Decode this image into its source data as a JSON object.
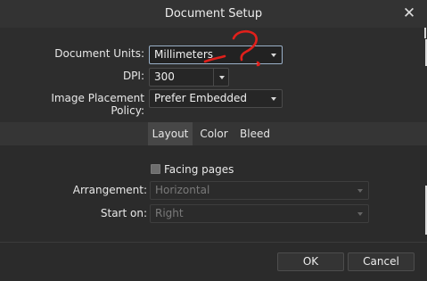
{
  "dialog": {
    "title": "Document Setup",
    "close_glyph": "✕"
  },
  "top": {
    "document_units": {
      "label": "Document Units:",
      "value": "Millimeters"
    },
    "dpi": {
      "label": "DPI:",
      "value": "300"
    },
    "placement": {
      "label": "Image Placement Policy:",
      "value": "Prefer Embedded"
    }
  },
  "tabs": [
    {
      "label": "Layout",
      "active": true
    },
    {
      "label": "Color",
      "active": false
    },
    {
      "label": "Bleed",
      "active": false
    }
  ],
  "layout": {
    "facing_pages": {
      "label": "Facing pages",
      "checked": false
    },
    "arrangement": {
      "label": "Arrangement:",
      "value": "Horizontal",
      "enabled": false
    },
    "start_on": {
      "label": "Start on:",
      "value": "Right",
      "enabled": false
    }
  },
  "footer": {
    "ok_label": "OK",
    "cancel_label": "Cancel"
  },
  "annotation": {
    "color": "#e0201b"
  }
}
